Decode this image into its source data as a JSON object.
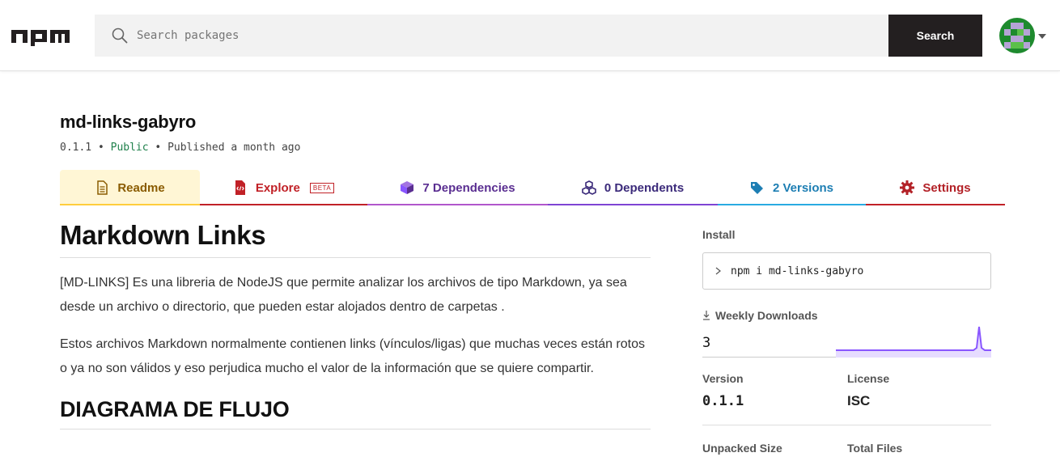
{
  "header": {
    "logo_text": "npm",
    "search_placeholder": "Search packages",
    "search_button_label": "Search"
  },
  "package": {
    "name": "md-links-gabyro",
    "version": "0.1.1",
    "visibility": "Public",
    "published": "Published a month ago"
  },
  "tabs": [
    {
      "label": "Readme",
      "icon": "document-icon",
      "color": "#8a5b00"
    },
    {
      "label": "Explore",
      "badge": "BETA",
      "icon": "file-code-icon",
      "color": "#c12127"
    },
    {
      "label": "7 Dependencies",
      "icon": "box-icon",
      "color": "#5a2e91"
    },
    {
      "label": "0 Dependents",
      "icon": "boxes-icon",
      "color": "#3b2a7a"
    },
    {
      "label": "2 Versions",
      "icon": "tags-icon",
      "color": "#1d7eb3"
    },
    {
      "label": "Settings",
      "icon": "gear-icon",
      "color": "#b32127"
    }
  ],
  "readme": {
    "title": "Markdown Links",
    "paragraph1": "[MD-LINKS] Es una libreria de NodeJS que permite analizar los archivos de tipo Markdown, ya sea desde un archivo o directorio, que pueden estar alojados dentro de carpetas .",
    "paragraph2": "Estos archivos Markdown normalmente contienen links (vínculos/ligas) que muchas veces están rotos o ya no son válidos y eso perjudica mucho el valor de la información que se quiere compartir.",
    "heading2": "DIAGRAMA DE FLUJO"
  },
  "sidebar": {
    "install_label": "Install",
    "install_command": "npm i md-links-gabyro",
    "weekly_downloads_label": "Weekly Downloads",
    "weekly_downloads": "3",
    "version_label": "Version",
    "version_value": "0.1.1",
    "license_label": "License",
    "license_value": "ISC",
    "unpacked_size_label": "Unpacked Size",
    "total_files_label": "Total Files"
  },
  "colors": {
    "brand_dark": "#231f20",
    "npm_red": "#c12127",
    "sparkline": "#8956ff",
    "public_green": "#20814c"
  }
}
